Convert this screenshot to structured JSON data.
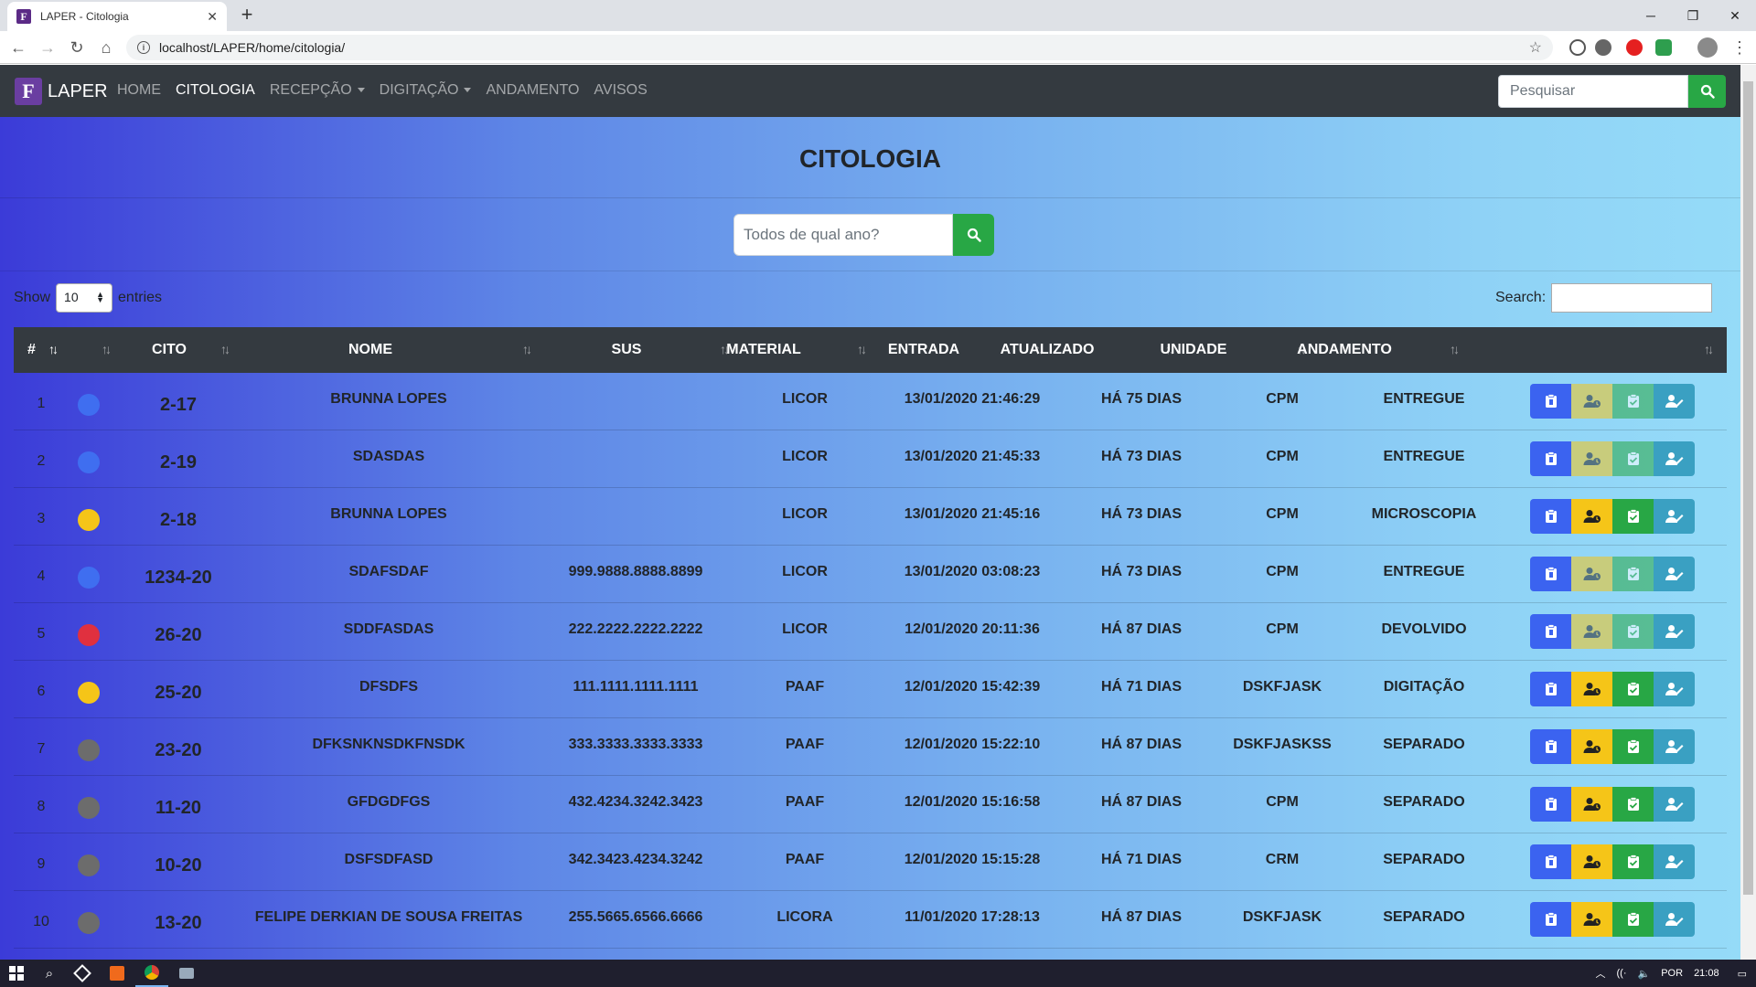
{
  "browser": {
    "tab_title": "LAPER - Citologia",
    "favicon_letter": "F",
    "url": "localhost/LAPER/home/citologia/"
  },
  "nav": {
    "brand": "LAPER",
    "logo_letter": "F",
    "items": [
      {
        "label": "HOME",
        "active": false,
        "dropdown": false
      },
      {
        "label": "CITOLOGIA",
        "active": true,
        "dropdown": false
      },
      {
        "label": "RECEPÇÃO",
        "active": false,
        "dropdown": true
      },
      {
        "label": "DIGITAÇÃO",
        "active": false,
        "dropdown": true
      },
      {
        "label": "ANDAMENTO",
        "active": false,
        "dropdown": false
      },
      {
        "label": "AVISOS",
        "active": false,
        "dropdown": false
      }
    ],
    "search_placeholder": "Pesquisar"
  },
  "page": {
    "title": "CITOLOGIA",
    "year_placeholder": "Todos de qual ano?",
    "show_label": "Show",
    "entries_label": "entries",
    "page_length": "10",
    "search_label": "Search:"
  },
  "table": {
    "columns": [
      "#",
      "",
      "CITO",
      "NOME",
      "SUS",
      "MATERIAL",
      "ENTRADA",
      "ATUALIZADO",
      "UNIDADE",
      "ANDAMENTO",
      ""
    ],
    "rows": [
      {
        "n": "1",
        "status": "blue",
        "cito": "2-17",
        "nome": "BRUNNA LOPES",
        "sus": "",
        "material": "LICOR",
        "entrada": "13/01/2020 21:46:29",
        "atualizado": "HÁ 75 DIAS",
        "unidade": "CPM",
        "andamento": "ENTREGUE",
        "enabled": false
      },
      {
        "n": "2",
        "status": "blue",
        "cito": "2-19",
        "nome": "SDASDAS",
        "sus": "",
        "material": "LICOR",
        "entrada": "13/01/2020 21:45:33",
        "atualizado": "HÁ 73 DIAS",
        "unidade": "CPM",
        "andamento": "ENTREGUE",
        "enabled": false
      },
      {
        "n": "3",
        "status": "yellow",
        "cito": "2-18",
        "nome": "BRUNNA LOPES",
        "sus": "",
        "material": "LICOR",
        "entrada": "13/01/2020 21:45:16",
        "atualizado": "HÁ 73 DIAS",
        "unidade": "CPM",
        "andamento": "MICROSCOPIA",
        "enabled": true
      },
      {
        "n": "4",
        "status": "blue",
        "cito": "1234-20",
        "nome": "SDAFSDAF",
        "sus": "999.9888.8888.8899",
        "material": "LICOR",
        "entrada": "13/01/2020 03:08:23",
        "atualizado": "HÁ 73 DIAS",
        "unidade": "CPM",
        "andamento": "ENTREGUE",
        "enabled": false
      },
      {
        "n": "5",
        "status": "red",
        "cito": "26-20",
        "nome": "SDDFASDAS",
        "sus": "222.2222.2222.2222",
        "material": "LICOR",
        "entrada": "12/01/2020 20:11:36",
        "atualizado": "HÁ 87 DIAS",
        "unidade": "CPM",
        "andamento": "DEVOLVIDO",
        "enabled": false
      },
      {
        "n": "6",
        "status": "yellow",
        "cito": "25-20",
        "nome": "DFSDFS",
        "sus": "111.1111.1111.1111",
        "material": "PAAF",
        "entrada": "12/01/2020 15:42:39",
        "atualizado": "HÁ 71 DIAS",
        "unidade": "DSKFJASK",
        "andamento": "DIGITAÇÃO",
        "enabled": true
      },
      {
        "n": "7",
        "status": "gray",
        "cito": "23-20",
        "nome": "DFKSNKNSDKFNSDK",
        "sus": "333.3333.3333.3333",
        "material": "PAAF",
        "entrada": "12/01/2020 15:22:10",
        "atualizado": "HÁ 87 DIAS",
        "unidade": "DSKFJASKSS",
        "andamento": "SEPARADO",
        "enabled": true
      },
      {
        "n": "8",
        "status": "gray",
        "cito": "11-20",
        "nome": "GFDGDFGS",
        "sus": "432.4234.3242.3423",
        "material": "PAAF",
        "entrada": "12/01/2020 15:16:58",
        "atualizado": "HÁ 87 DIAS",
        "unidade": "CPM",
        "andamento": "SEPARADO",
        "enabled": true
      },
      {
        "n": "9",
        "status": "gray",
        "cito": "10-20",
        "nome": "DSFSDFASD",
        "sus": "342.3423.4234.3242",
        "material": "PAAF",
        "entrada": "12/01/2020 15:15:28",
        "atualizado": "HÁ 71 DIAS",
        "unidade": "CRM",
        "andamento": "SEPARADO",
        "enabled": true
      },
      {
        "n": "10",
        "status": "gray",
        "cito": "13-20",
        "nome": "FELIPE DERKIAN DE SOUSA FREITAS",
        "sus": "255.5665.6566.6666",
        "material": "LICORA",
        "entrada": "11/01/2020 17:28:13",
        "atualizado": "HÁ 87 DIAS",
        "unidade": "DSKFJASK",
        "andamento": "SEPARADO",
        "enabled": true
      }
    ]
  },
  "status_colors": {
    "blue": "#3f6ef0",
    "yellow": "#f5c518",
    "red": "#e0303f",
    "gray": "#6c6c6c"
  },
  "action_colors": [
    "#3b63f0",
    "#f5c518",
    "#28a745",
    "#3aa0c2"
  ],
  "taskbar": {
    "lang": "POR",
    "time": "21:08"
  }
}
